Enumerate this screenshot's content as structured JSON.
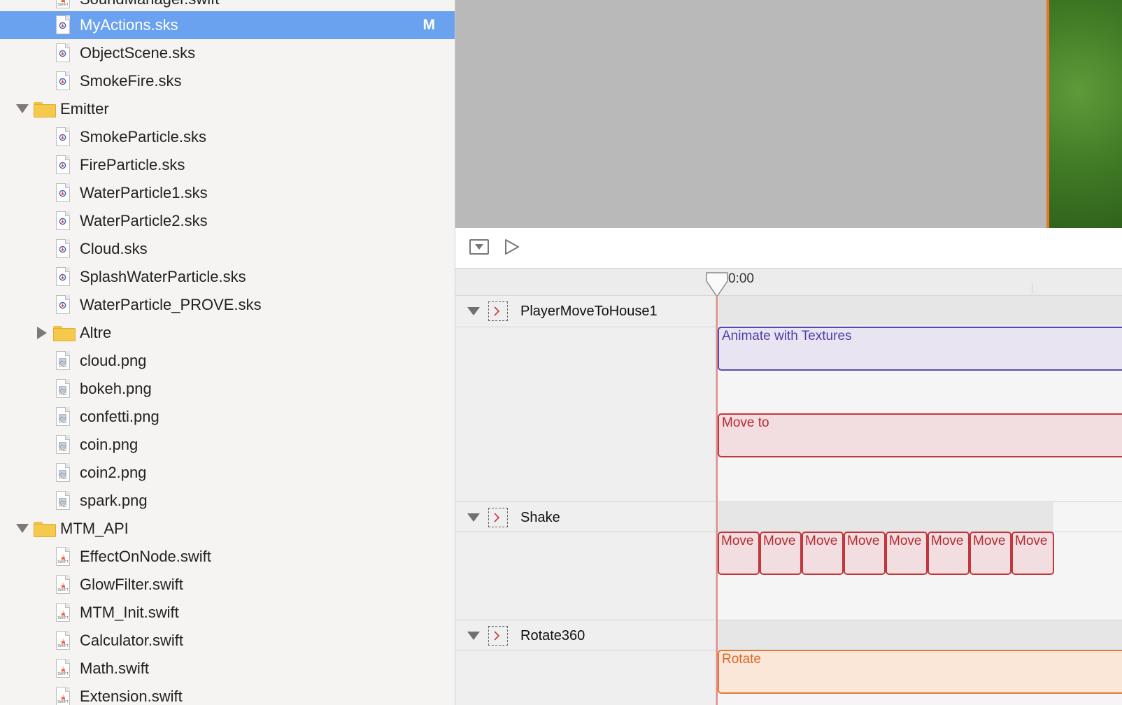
{
  "navigator": {
    "items": [
      {
        "label": "SoundManager.swift",
        "kind": "swift"
      },
      {
        "label": "MyActions.sks",
        "kind": "sks",
        "selected": true,
        "badge": "M"
      },
      {
        "label": "ObjectScene.sks",
        "kind": "sks"
      },
      {
        "label": "SmokeFire.sks",
        "kind": "sks"
      },
      {
        "label": "Emitter",
        "kind": "folder",
        "expanded": true
      },
      {
        "label": "SmokeParticle.sks",
        "kind": "sks"
      },
      {
        "label": "FireParticle.sks",
        "kind": "sks"
      },
      {
        "label": "WaterParticle1.sks",
        "kind": "sks"
      },
      {
        "label": "WaterParticle2.sks",
        "kind": "sks"
      },
      {
        "label": "Cloud.sks",
        "kind": "sks"
      },
      {
        "label": "SplashWaterParticle.sks",
        "kind": "sks"
      },
      {
        "label": "WaterParticle_PROVE.sks",
        "kind": "sks"
      },
      {
        "label": "Altre",
        "kind": "folder",
        "expanded": false
      },
      {
        "label": "cloud.png",
        "kind": "png"
      },
      {
        "label": "bokeh.png",
        "kind": "png"
      },
      {
        "label": "confetti.png",
        "kind": "png"
      },
      {
        "label": "coin.png",
        "kind": "png"
      },
      {
        "label": "coin2.png",
        "kind": "png"
      },
      {
        "label": "spark.png",
        "kind": "png"
      },
      {
        "label": "MTM_API",
        "kind": "folder",
        "expanded": true
      },
      {
        "label": "EffectOnNode.swift",
        "kind": "swift"
      },
      {
        "label": "GlowFilter.swift",
        "kind": "swift"
      },
      {
        "label": "MTM_Init.swift",
        "kind": "swift"
      },
      {
        "label": "Calculator.swift",
        "kind": "swift"
      },
      {
        "label": "Math.swift",
        "kind": "swift"
      },
      {
        "label": "Extension.swift",
        "kind": "swift"
      }
    ],
    "file_caption_png": "PNG",
    "file_caption_swift": "SWIFT"
  },
  "editor": {
    "ruler_time": "0:00",
    "tracks": [
      {
        "name": "PlayerMoveToHouse1",
        "actions": [
          "Animate with Textures",
          "Move to"
        ]
      },
      {
        "name": "Shake",
        "actions": [
          "Move",
          "Move",
          "Move",
          "Move",
          "Move",
          "Move",
          "Move",
          "Move"
        ]
      },
      {
        "name": "Rotate360",
        "actions": [
          "Rotate"
        ]
      }
    ]
  },
  "colors": {
    "selection": "#6aa2f0",
    "texture_action": "#5a49b2",
    "move_action": "#c2373c",
    "rotate_action": "#e3793c",
    "playhead": "#e88a86"
  }
}
